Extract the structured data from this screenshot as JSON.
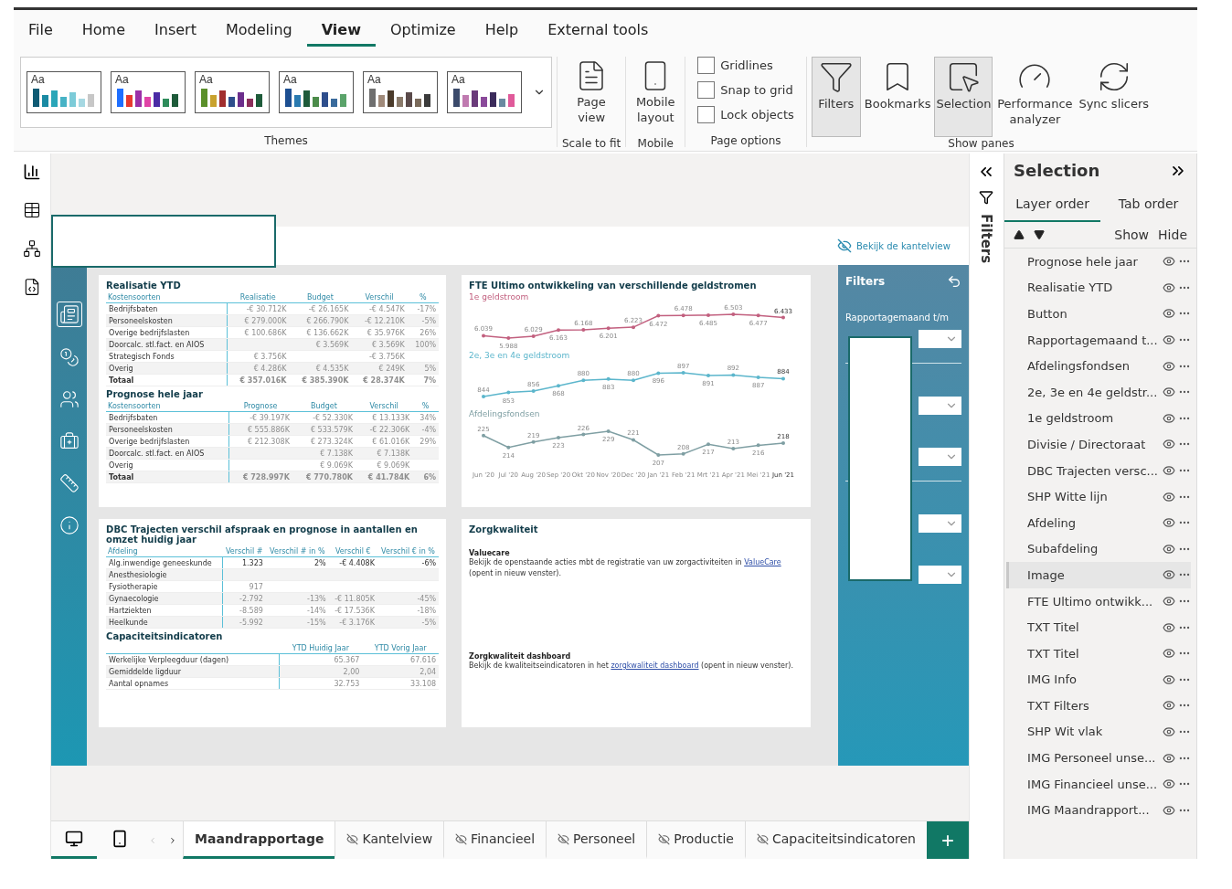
{
  "menu": [
    {
      "label": "File",
      "selected": false
    },
    {
      "label": "Home",
      "selected": false
    },
    {
      "label": "Insert",
      "selected": false
    },
    {
      "label": "Modeling",
      "selected": false
    },
    {
      "label": "View",
      "selected": true
    },
    {
      "label": "Optimize",
      "selected": false
    },
    {
      "label": "Help",
      "selected": false
    },
    {
      "label": "External tools",
      "selected": false
    }
  ],
  "themes": {
    "label": "Themes",
    "items": [
      {
        "sample": "Aa"
      },
      {
        "sample": "Aa"
      },
      {
        "sample": "Aa"
      },
      {
        "sample": "Aa"
      },
      {
        "sample": "Aa"
      },
      {
        "sample": "Aa"
      }
    ]
  },
  "scale_group": {
    "label": "Scale to fit",
    "button": "Page view"
  },
  "mobile_group": {
    "label": "Mobile",
    "button": "Mobile layout"
  },
  "page_options": {
    "label": "Page options",
    "checkboxes": [
      {
        "label": "Gridlines",
        "checked": false
      },
      {
        "label": "Snap to grid",
        "checked": false
      },
      {
        "label": "Lock objects",
        "checked": false
      }
    ]
  },
  "show_panes": {
    "label": "Show panes",
    "buttons": [
      {
        "label": "Filters",
        "kind": "filters",
        "selected": true
      },
      {
        "label": "Bookmarks",
        "kind": "bookmarks",
        "selected": false
      },
      {
        "label": "Selection",
        "kind": "selection",
        "selected": true
      },
      {
        "label": "Performance analyzer",
        "kind": "performance",
        "selected": false
      },
      {
        "label": "Sync slicers",
        "kind": "sync",
        "selected": false
      }
    ]
  },
  "report": {
    "header_link": "Bekijk de kantelview",
    "realisatie": {
      "title": "Realisatie YTD",
      "columns": [
        "Kostensoorten",
        "Realisatie",
        "Budget",
        "Verschil",
        "%"
      ],
      "rows": [
        {
          "kind": "row",
          "cells": [
            "Bedrijfsbaten",
            "-€ 30.712K",
            "-€ 26.165K",
            "-€ 4.547K",
            "-17%"
          ]
        },
        {
          "kind": "row",
          "cells": [
            "Personeelskosten",
            "€ 279.000K",
            "€ 266.790K",
            "-€ 12.210K",
            "-5%"
          ]
        },
        {
          "kind": "row",
          "cells": [
            "Overige bedrijfslasten",
            "€ 100.686K",
            "€ 136.662K",
            "€ 35.976K",
            "26%"
          ]
        },
        {
          "kind": "row",
          "cells": [
            "Doorcalc. stl.fact. en AIOS",
            "",
            "€ 3.569K",
            "€ 3.569K",
            "100%"
          ]
        },
        {
          "kind": "row",
          "cells": [
            "Strategisch Fonds",
            "€ 3.756K",
            "",
            "-€ 3.756K",
            ""
          ]
        },
        {
          "kind": "row",
          "cells": [
            "Overig",
            "€ 4.286K",
            "€ 4.535K",
            "€ 249K",
            "5%"
          ]
        },
        {
          "kind": "total",
          "cells": [
            "Totaal",
            "€ 357.016K",
            "€ 385.390K",
            "€ 28.374K",
            "7%"
          ]
        }
      ]
    },
    "prognose": {
      "title": "Prognose hele jaar",
      "columns": [
        "Kostensoorten",
        "Prognose",
        "Budget",
        "Verschil",
        "%"
      ],
      "rows": [
        {
          "kind": "row",
          "cells": [
            "Bedrijfsbaten",
            "-€ 39.197K",
            "-€ 52.330K",
            "€ 13.133K",
            "34%"
          ]
        },
        {
          "kind": "row",
          "cells": [
            "Personeelskosten",
            "€ 555.886K",
            "€ 533.579K",
            "-€ 22.306K",
            "-4%"
          ]
        },
        {
          "kind": "row",
          "cells": [
            "Overige bedrijfslasten",
            "€ 212.308K",
            "€ 273.324K",
            "€ 61.016K",
            "29%"
          ]
        },
        {
          "kind": "row",
          "cells": [
            "Doorcalc. stl.fact. en AIOS",
            "",
            "€ 7.138K",
            "€ 7.138K",
            ""
          ]
        },
        {
          "kind": "row",
          "cells": [
            "Overig",
            "",
            "€ 9.069K",
            "€ 9.069K",
            ""
          ]
        },
        {
          "kind": "total",
          "cells": [
            "Totaal",
            "€ 728.997K",
            "€ 770.780K",
            "€ 41.784K",
            "6%"
          ]
        }
      ]
    },
    "fte": {
      "title": "FTE Ultimo ontwikkeling van verschillende geldstromen",
      "charts": [
        {
          "chart_data": {
            "type": "line",
            "series": [
              {
                "name": "1e geldstroom",
                "color": "#c2607f",
                "values": [
                  6039,
                  5988,
                  6029,
                  6163,
                  6168,
                  6201,
                  6223,
                  6472,
                  6478,
                  6485,
                  6503,
                  6477,
                  6433
                ],
                "value_labels": [
                  "6.039",
                  "5.988",
                  "6.029",
                  "6.163",
                  "6.168",
                  "6.201",
                  "6.223",
                  "6.472",
                  "6.478",
                  "6.485",
                  "6.503",
                  "6.477",
                  "6.433"
                ]
              }
            ]
          }
        },
        {
          "chart_data": {
            "type": "line",
            "series": [
              {
                "name": "2e, 3e en 4e geldstroom",
                "color": "#5cb6cc",
                "values": [
                  844,
                  853,
                  856,
                  868,
                  880,
                  883,
                  880,
                  896,
                  897,
                  891,
                  892,
                  887,
                  884
                ],
                "value_labels": [
                  "844",
                  "853",
                  "856",
                  "868",
                  "880",
                  "883",
                  "880",
                  "896",
                  "897",
                  "891",
                  "892",
                  "887",
                  "884"
                ]
              }
            ]
          }
        },
        {
          "chart_data": {
            "type": "line",
            "categories": [
              "Jun '20",
              "Jul '20",
              "Aug '20",
              "Sep '20",
              "Okt '20",
              "Nov '20",
              "Dec '20",
              "Jan '21",
              "Feb '21",
              "Mrt '21",
              "Apr '21",
              "Mei '21",
              "Jun '21"
            ],
            "series": [
              {
                "name": "Afdelingsfondsen",
                "color": "#7f9fa3",
                "values": [
                  225,
                  214,
                  219,
                  223,
                  226,
                  229,
                  221,
                  207,
                  208,
                  217,
                  213,
                  216,
                  218
                ],
                "value_labels": [
                  "225",
                  "214",
                  "219",
                  "223",
                  "226",
                  "229",
                  "221",
                  "207",
                  "208",
                  "217",
                  "213",
                  "216",
                  "218"
                ]
              }
            ]
          }
        }
      ]
    },
    "dbc": {
      "title": "DBC Trajecten verschil afspraak en prognose in aantallen en omzet huidig jaar",
      "columns": [
        "Afdeling",
        "Verschil #",
        "Verschil # in %",
        "Verschil €",
        "Verschil € in %"
      ],
      "rows": [
        {
          "kind": "row",
          "dimmed": false,
          "cells": [
            "Alg.inwendige geneeskunde",
            "1.323",
            "2%",
            "-€ 4.408K",
            "-6%"
          ]
        },
        {
          "kind": "row",
          "cells": [
            "Anesthesiologie",
            "",
            "",
            "",
            ""
          ]
        },
        {
          "kind": "row",
          "dimmed": true,
          "cells": [
            "Fysiotherapie",
            "917",
            "",
            "",
            ""
          ]
        },
        {
          "kind": "row",
          "dimmed": true,
          "cells": [
            "Gynaecologie",
            "-2.792",
            "-13%",
            "-€ 11.805K",
            "-45%"
          ]
        },
        {
          "kind": "row",
          "dimmed": true,
          "cells": [
            "Hartziekten",
            "-8.589",
            "-14%",
            "-€ 17.536K",
            "-18%"
          ]
        },
        {
          "kind": "row",
          "dimmed": true,
          "cells": [
            "Heelkunde",
            "-5.992",
            "-15%",
            "-€ 3.176K",
            "-5%"
          ]
        }
      ]
    },
    "capaciteit": {
      "title": "Capaciteitsindicatoren",
      "columns": [
        "",
        "YTD Huidig Jaar",
        "YTD Vorig Jaar"
      ],
      "rows": [
        {
          "kind": "row",
          "cells": [
            "Werkelijke Verpleegduur (dagen)",
            "65.367",
            "67.616"
          ]
        },
        {
          "kind": "row",
          "cells": [
            "Gemiddelde ligduur",
            "2,00",
            "2,04"
          ]
        },
        {
          "kind": "row",
          "cells": [
            "Aantal opnames",
            "32.753",
            "33.108"
          ]
        }
      ]
    },
    "zorg": {
      "title": "Zorgkwaliteit",
      "sections": [
        {
          "heading": "Valuecare",
          "before": "Bekijk de openstaande acties mbt de registratie van uw zorgactiviteiten  in ",
          "link": "ValueCare",
          "after": " (opent in nieuw venster)."
        },
        {
          "heading": "Zorgkwaliteit dashboard",
          "before": "Bekijk de kwaliteitseindicatoren in het ",
          "link": "zorgkwaliteit dashboard",
          "after": " (opent in nieuw venster)."
        }
      ]
    },
    "filters": {
      "title": "Filters",
      "label": "Rapportagemaand t/m"
    }
  },
  "filters_strip": {
    "label": "Filters"
  },
  "selection": {
    "title": "Selection",
    "tabs": [
      {
        "label": "Layer order",
        "selected": true
      },
      {
        "label": "Tab order",
        "selected": false
      }
    ],
    "show": "Show",
    "hide": "Hide",
    "items": [
      {
        "label": "Prognose hele jaar",
        "selected": false
      },
      {
        "label": "Realisatie YTD",
        "selected": false
      },
      {
        "label": "Button",
        "selected": false
      },
      {
        "label": "Rapportagemaand t...",
        "selected": false
      },
      {
        "label": "Afdelingsfondsen",
        "selected": false
      },
      {
        "label": "2e, 3e en 4e geldstr...",
        "selected": false
      },
      {
        "label": "1e geldstroom",
        "selected": false
      },
      {
        "label": "Divisie / Directoraat",
        "selected": false
      },
      {
        "label": "DBC Trajecten versc...",
        "selected": false
      },
      {
        "label": "SHP Witte lijn",
        "selected": false
      },
      {
        "label": "Afdeling",
        "selected": false
      },
      {
        "label": "Subafdeling",
        "selected": false
      },
      {
        "label": "Image",
        "selected": true
      },
      {
        "label": "FTE Ultimo ontwikk...",
        "selected": false
      },
      {
        "label": "TXT Titel",
        "selected": false
      },
      {
        "label": "TXT Titel",
        "selected": false
      },
      {
        "label": "IMG Info",
        "selected": false
      },
      {
        "label": "TXT Filters",
        "selected": false
      },
      {
        "label": "SHP Wit vlak",
        "selected": false
      },
      {
        "label": "IMG Personeel unse...",
        "selected": false
      },
      {
        "label": "IMG Financieel unse...",
        "selected": false
      },
      {
        "label": "IMG Maandrapport...",
        "selected": false
      }
    ]
  },
  "page_tabs": [
    {
      "label": "Maandrapportage",
      "selected": true,
      "hidden": false
    },
    {
      "label": "Kantelview",
      "selected": false,
      "hidden": true
    },
    {
      "label": "Financieel",
      "selected": false,
      "hidden": true
    },
    {
      "label": "Personeel",
      "selected": false,
      "hidden": true
    },
    {
      "label": "Productie",
      "selected": false,
      "hidden": true
    },
    {
      "label": "Capaciteitsindicatoren",
      "selected": false,
      "hidden": true
    }
  ],
  "add_page": "+"
}
